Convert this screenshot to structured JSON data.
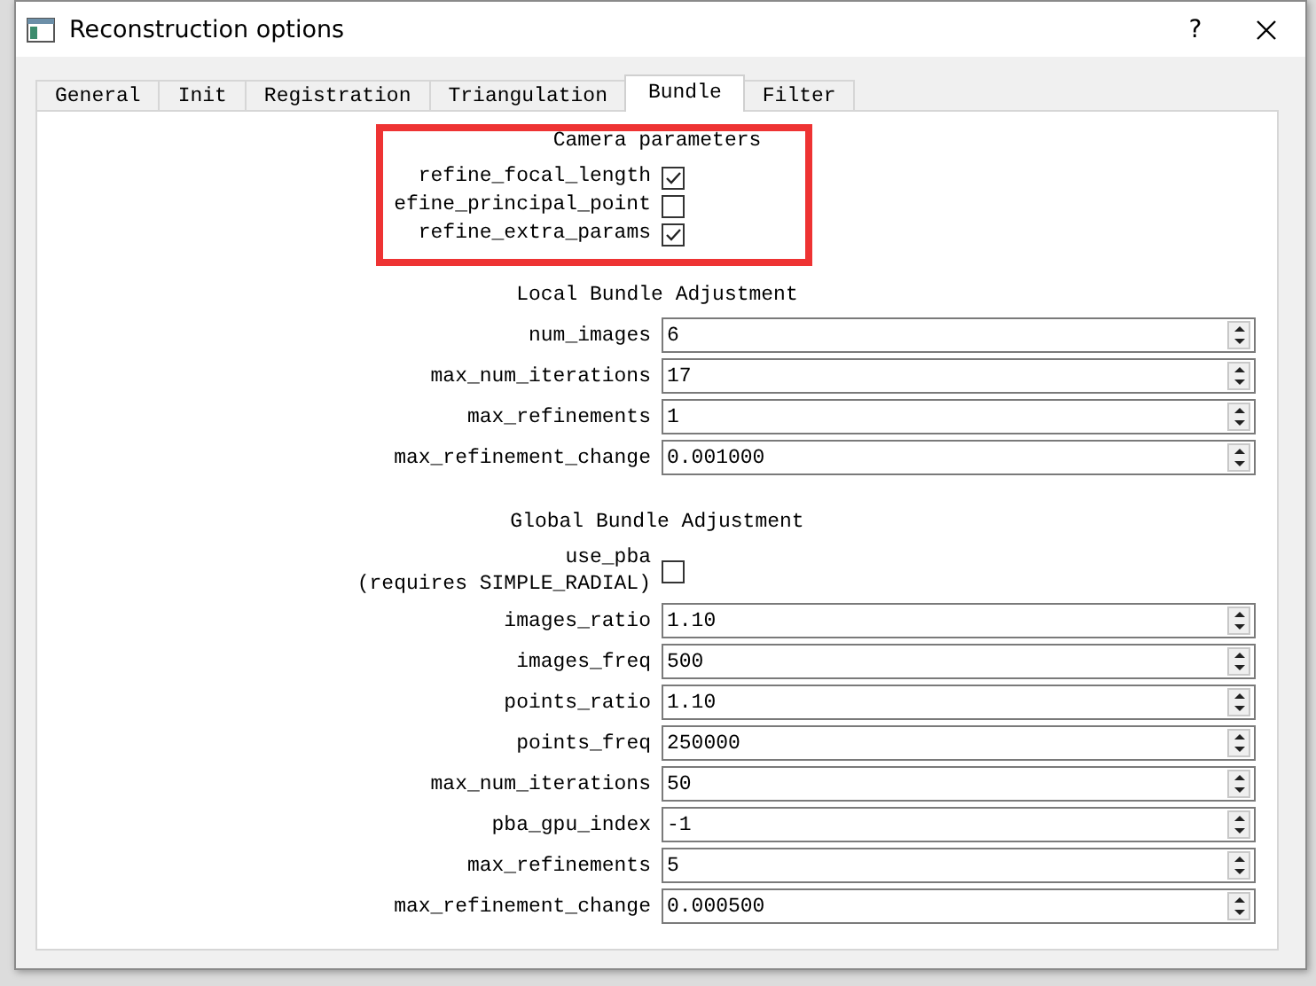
{
  "window": {
    "title": "Reconstruction options",
    "help": "?"
  },
  "tabs": [
    {
      "label": "General",
      "selected": false
    },
    {
      "label": "Init",
      "selected": false
    },
    {
      "label": "Registration",
      "selected": false
    },
    {
      "label": "Triangulation",
      "selected": false
    },
    {
      "label": "Bundle",
      "selected": true
    },
    {
      "label": "Filter",
      "selected": false
    }
  ],
  "sections": [
    {
      "heading": "Camera parameters",
      "fields": [
        {
          "kind": "checkbox",
          "label": "refine_focal_length",
          "checked": true
        },
        {
          "kind": "checkbox",
          "label": "efine_principal_point",
          "checked": false
        },
        {
          "kind": "checkbox",
          "label": "refine_extra_params",
          "checked": true
        }
      ]
    },
    {
      "heading": "Local Bundle Adjustment",
      "fields": [
        {
          "kind": "spin",
          "label": "num_images",
          "value": "6"
        },
        {
          "kind": "spin",
          "label": "max_num_iterations",
          "value": "17"
        },
        {
          "kind": "spin",
          "label": "max_refinements",
          "value": "1"
        },
        {
          "kind": "spin",
          "label": "max_refinement_change",
          "value": "0.001000"
        }
      ]
    },
    {
      "heading": "Global Bundle Adjustment",
      "fields": [
        {
          "kind": "checkbox",
          "label": "use_pba\n(requires SIMPLE_RADIAL)",
          "checked": false
        },
        {
          "kind": "spin",
          "label": "images_ratio",
          "value": "1.10"
        },
        {
          "kind": "spin",
          "label": "images_freq",
          "value": "500"
        },
        {
          "kind": "spin",
          "label": "points_ratio",
          "value": "1.10"
        },
        {
          "kind": "spin",
          "label": "points_freq",
          "value": "250000"
        },
        {
          "kind": "spin",
          "label": "max_num_iterations",
          "value": "50"
        },
        {
          "kind": "spin",
          "label": "pba_gpu_index",
          "value": "-1"
        },
        {
          "kind": "spin",
          "label": "max_refinements",
          "value": "5"
        },
        {
          "kind": "spin",
          "label": "max_refinement_change",
          "value": "0.000500"
        }
      ]
    }
  ]
}
